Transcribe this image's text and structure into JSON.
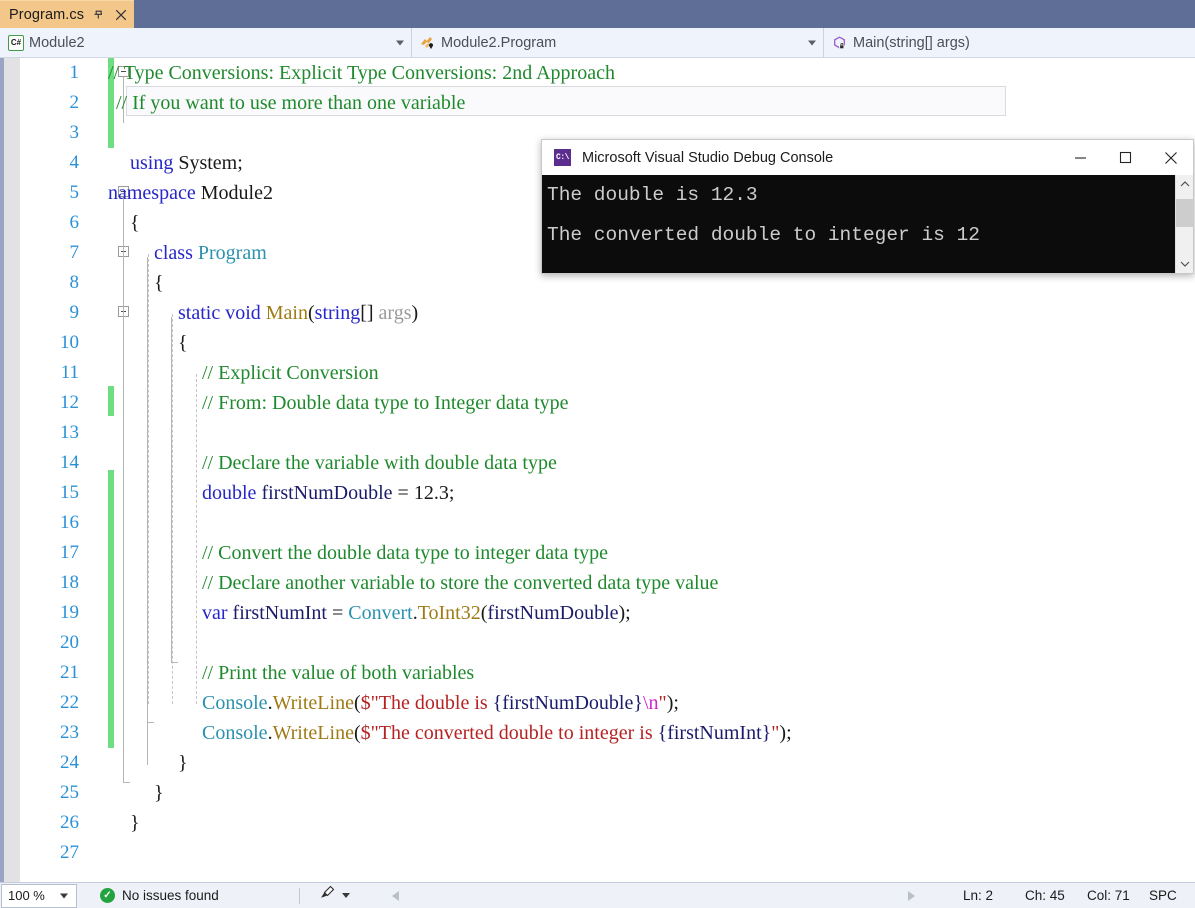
{
  "window": {
    "tab": {
      "label": "Program.cs",
      "pin_icon": "pin-icon",
      "close_icon": "close-icon"
    }
  },
  "navbar": {
    "project": {
      "icon": "csharp-file-icon",
      "text": "Module2"
    },
    "type": {
      "icon": "class-members-icon",
      "text": "Module2.Program"
    },
    "member": {
      "icon": "method-private-icon",
      "text": "Main(string[] args)"
    }
  },
  "editor": {
    "lines": [
      {
        "n": "1",
        "text": "// Type Conversions: Explicit Type Conversions: 2nd Approach"
      },
      {
        "n": "2",
        "text": "// If you want to use more than one variable"
      },
      {
        "n": "3",
        "text": ""
      },
      {
        "n": "4",
        "text": "using System;"
      },
      {
        "n": "5",
        "text": "namespace Module2"
      },
      {
        "n": "6",
        "text": "{"
      },
      {
        "n": "7",
        "text": "class Program"
      },
      {
        "n": "8",
        "text": "{"
      },
      {
        "n": "9",
        "text": "static void Main(string[] args)"
      },
      {
        "n": "10",
        "text": "{"
      },
      {
        "n": "11",
        "text": "// Explicit Conversion"
      },
      {
        "n": "12",
        "text": "// From: Double data type to Integer data type"
      },
      {
        "n": "13",
        "text": ""
      },
      {
        "n": "14",
        "text": "// Declare the variable with double data type"
      },
      {
        "n": "15",
        "text": "double firstNumDouble = 12.3;"
      },
      {
        "n": "16",
        "text": ""
      },
      {
        "n": "17",
        "text": "// Convert the double data type to integer data type"
      },
      {
        "n": "18",
        "text": "// Declare another variable to store the converted data type value"
      },
      {
        "n": "19",
        "text": "var firstNumInt = Convert.ToInt32(firstNumDouble);"
      },
      {
        "n": "20",
        "text": ""
      },
      {
        "n": "21",
        "text": "// Print the value of both variables"
      },
      {
        "n": "22",
        "text": "Console.WriteLine($\"The double is {firstNumDouble}\\n\");"
      },
      {
        "n": "23",
        "text": "Console.WriteLine($\"The converted double to integer is {firstNumInt}\");"
      },
      {
        "n": "24",
        "text": "}"
      },
      {
        "n": "25",
        "text": "}"
      },
      {
        "n": "26",
        "text": "}"
      },
      {
        "n": "27",
        "text": ""
      }
    ],
    "tokens": {
      "comment1": "// Type Conversions: Explicit Type Conversions: 2nd Approach",
      "comment2": "// If you want to use more than one variable",
      "kw_using": "using",
      "id_system": " System;",
      "kw_namespace": "namespace",
      "id_module2": " Module2",
      "brace_open": "{",
      "brace_close": "}",
      "kw_class": "class",
      "type_program": " Program",
      "kw_static_void": "static void",
      "method_main": " Main",
      "paren_open": "(",
      "kw_string": "string",
      "brackets": "[] ",
      "param_args": "args",
      "paren_close": ")",
      "comment_explicit": "// Explicit Conversion",
      "comment_from": "// From: Double data type to Integer data type",
      "comment_declare": "// Declare the variable with double data type",
      "kw_double": "double",
      "id_firstnumdouble_decl": " firstNumDouble ",
      "op_eq": "= ",
      "num_123": "12.3",
      "semi": ";",
      "comment_convert": "// Convert the double data type to integer data type",
      "comment_declare2": "// Declare another variable to store the converted data type value",
      "kw_var": "var",
      "id_firstnumint_decl": " firstNumInt ",
      "type_convert": "Convert",
      "dot": ".",
      "method_toint32": "ToInt32",
      "id_firstnumdouble_arg": "firstNumDouble",
      "close_semi": ");",
      "comment_print": "// Print the value of both variables",
      "type_console": "Console",
      "method_writeline": "WriteLine",
      "str_interp_open": "$\"",
      "str_the_double_is": "The double is ",
      "interp_firstnumdouble": "{firstNumDouble}",
      "escape_n": "\\n",
      "str_quote_close": "\"",
      "str_the_converted": "The converted double to integer is ",
      "interp_firstnumint": "{firstNumInt}"
    }
  },
  "console": {
    "title": "Microsoft Visual Studio Debug Console",
    "icon": "console-app-icon",
    "minimize_icon": "minimize-icon",
    "maximize_icon": "maximize-icon",
    "close_icon": "close-icon",
    "output_line1": "The double is 12.3",
    "output_line2": "",
    "output_line3": "The converted double to integer is 12",
    "scroll_up_icon": "chevron-up-icon",
    "scroll_down_icon": "chevron-down-icon"
  },
  "statusbar": {
    "zoom": "100 %",
    "issues": "No issues found",
    "issues_icon": "check-circle-icon",
    "brush_icon": "feedback-brush-icon",
    "nav_back_icon": "triangle-left-icon",
    "nav_forward_icon": "triangle-right-icon",
    "ln": "Ln: 2",
    "ch": "Ch: 45",
    "col": "Col: 71",
    "spaces": "SPC"
  },
  "colors": {
    "tab_active": "#f2c789",
    "titlebar_bg": "#5f6e96",
    "change_bar": "#6fdd82",
    "line_number": "#2b91d6",
    "comment": "#1f8a2d",
    "keyword": "#2626c9",
    "type": "#2b91af",
    "method": "#9e7b15",
    "string": "#b52222",
    "escape": "#d024d0",
    "console_bg": "#0c0c0c",
    "console_fg": "#cccccc"
  }
}
